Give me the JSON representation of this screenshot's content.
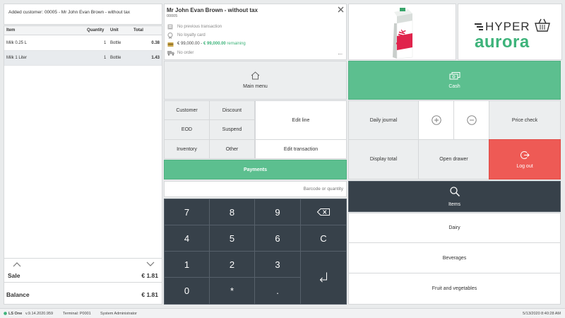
{
  "receipt": {
    "customer_msg": "Added customer: 00005 - Mr John Evan Brown - without tax",
    "headers": {
      "item": "Item",
      "quantity": "Quantity",
      "unit": "Unit",
      "total": "Total"
    },
    "lines": [
      {
        "item": "Milk 0.25 L",
        "quantity": "1",
        "unit": "Bottle",
        "total": "0.38"
      },
      {
        "item": "Milk 1 Liter",
        "quantity": "1",
        "unit": "Bottle",
        "total": "1.43"
      }
    ],
    "sale_label": "Sale",
    "sale_value": "€ 1.81",
    "balance_label": "Balance",
    "balance_value": "€ 1.81"
  },
  "customer": {
    "name": "Mr John Evan Brown - without tax",
    "id": "00005",
    "prev_tx": "No previous transaction",
    "loyalty": "No loyalty card",
    "credit_limit": "€ 99,000.00 -",
    "credit_remaining_amount": "€ 99,000.00",
    "credit_remaining_word": "remaining",
    "order": "No order",
    "more": "..."
  },
  "product_image": {
    "label": "Milk"
  },
  "logo": {
    "line1": "HYPER",
    "line2": "aurora"
  },
  "buttons": {
    "main_menu": "Main menu",
    "cash": "Cash",
    "customer": "Customer",
    "discount": "Discount",
    "edit_line": "Edit line",
    "eod": "EOD",
    "suspend": "Suspend",
    "inventory": "Inventory",
    "other": "Other",
    "edit_transaction": "Edit transaction",
    "payments": "Payments",
    "daily_journal": "Daily journal",
    "price_check": "Price check",
    "display_total": "Display total",
    "open_drawer": "Open drawer",
    "log_out": "Log out",
    "items": "Items",
    "dairy": "Dairy",
    "beverages": "Beverages",
    "fruit_veg": "Fruit and  vegetables"
  },
  "barcode": {
    "placeholder": "Barcode or quantity"
  },
  "keypad": {
    "k7": "7",
    "k8": "8",
    "k9": "9",
    "k4": "4",
    "k5": "5",
    "k6": "6",
    "kc": "C",
    "k1": "1",
    "k2": "2",
    "k3": "3",
    "k0": "0",
    "kstar": "*",
    "kdot": "."
  },
  "status": {
    "app": "LS One",
    "version": "v.9.14.2020.959",
    "terminal": "Terminal: P0001",
    "user": "System Administrator",
    "datetime": "5/13/2020 8:40:28 AM"
  },
  "colors": {
    "green": "#5cbf8f",
    "red": "#ee5a55",
    "dark": "#37414a",
    "brand_green": "#3db37a"
  }
}
